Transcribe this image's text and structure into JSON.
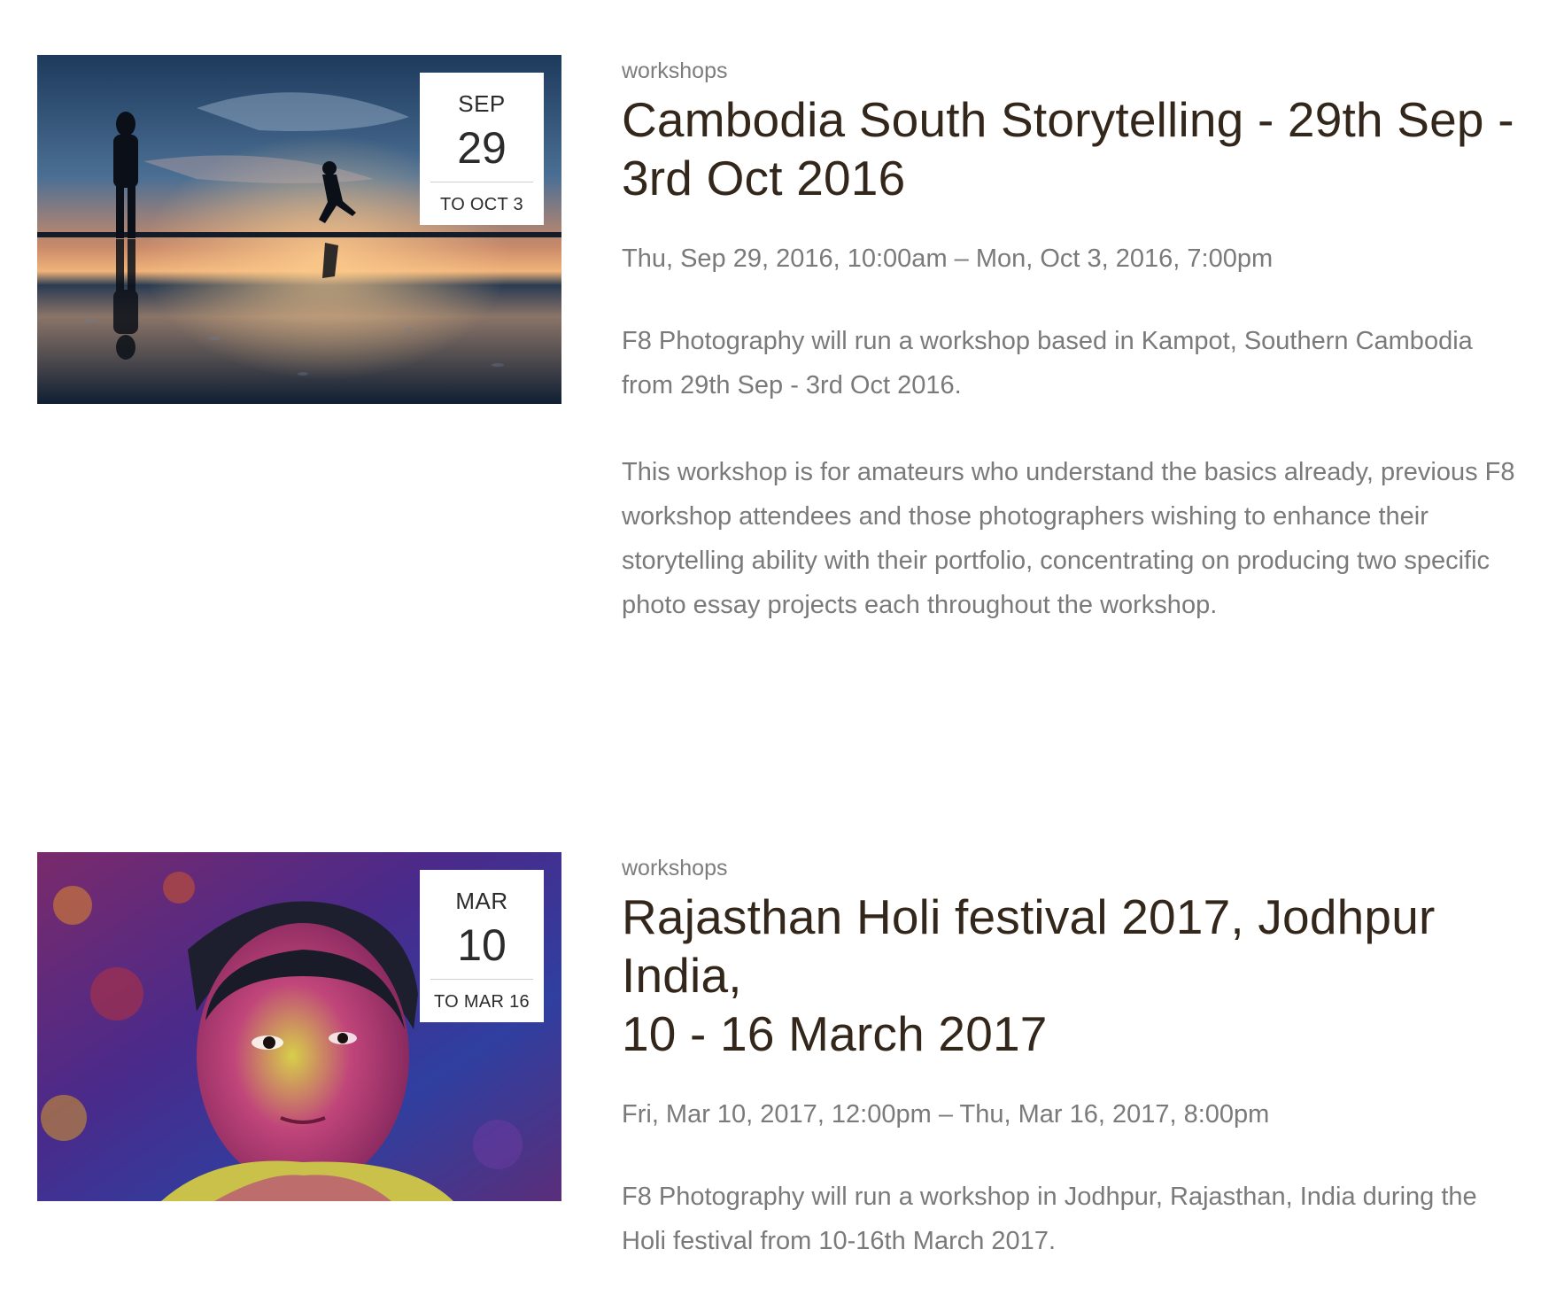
{
  "events": [
    {
      "category": "workshops",
      "title_line1": "Cambodia South Storytelling - 29th Sep -",
      "title_line2": "3rd Oct 2016",
      "date_month": "SEP",
      "date_day": "29",
      "date_to": "TO OCT 3",
      "datetime": "Thu, Sep 29, 2016, 10:00am – Mon, Oct 3, 2016, 7:00pm",
      "paragraphs": [
        "F8 Photography will run a workshop based in Kampot, Southern Cambodia from 29th Sep - 3rd Oct 2016.",
        "This workshop is for amateurs who understand the basics already, previous F8 workshop attendees and those photographers wishing to enhance their storytelling ability with their portfolio, concentrating on producing two specific photo essay projects each throughout the workshop."
      ]
    },
    {
      "category": "workshops",
      "title_line1": "Rajasthan Holi festival 2017, Jodhpur India,",
      "title_line2": "10 - 16 March 2017",
      "date_month": "MAR",
      "date_day": "10",
      "date_to": "TO MAR 16",
      "datetime": "Fri, Mar 10, 2017, 12:00pm – Thu, Mar 16, 2017, 8:00pm",
      "paragraphs": [
        "F8 Photography will run a workshop in Jodhpur, Rajasthan, India during the Holi festival from 10-16th March 2017."
      ]
    }
  ],
  "colors": {
    "title": "#33261a",
    "body_text": "#7a7a7a",
    "datebox_bg": "#ffffff"
  }
}
